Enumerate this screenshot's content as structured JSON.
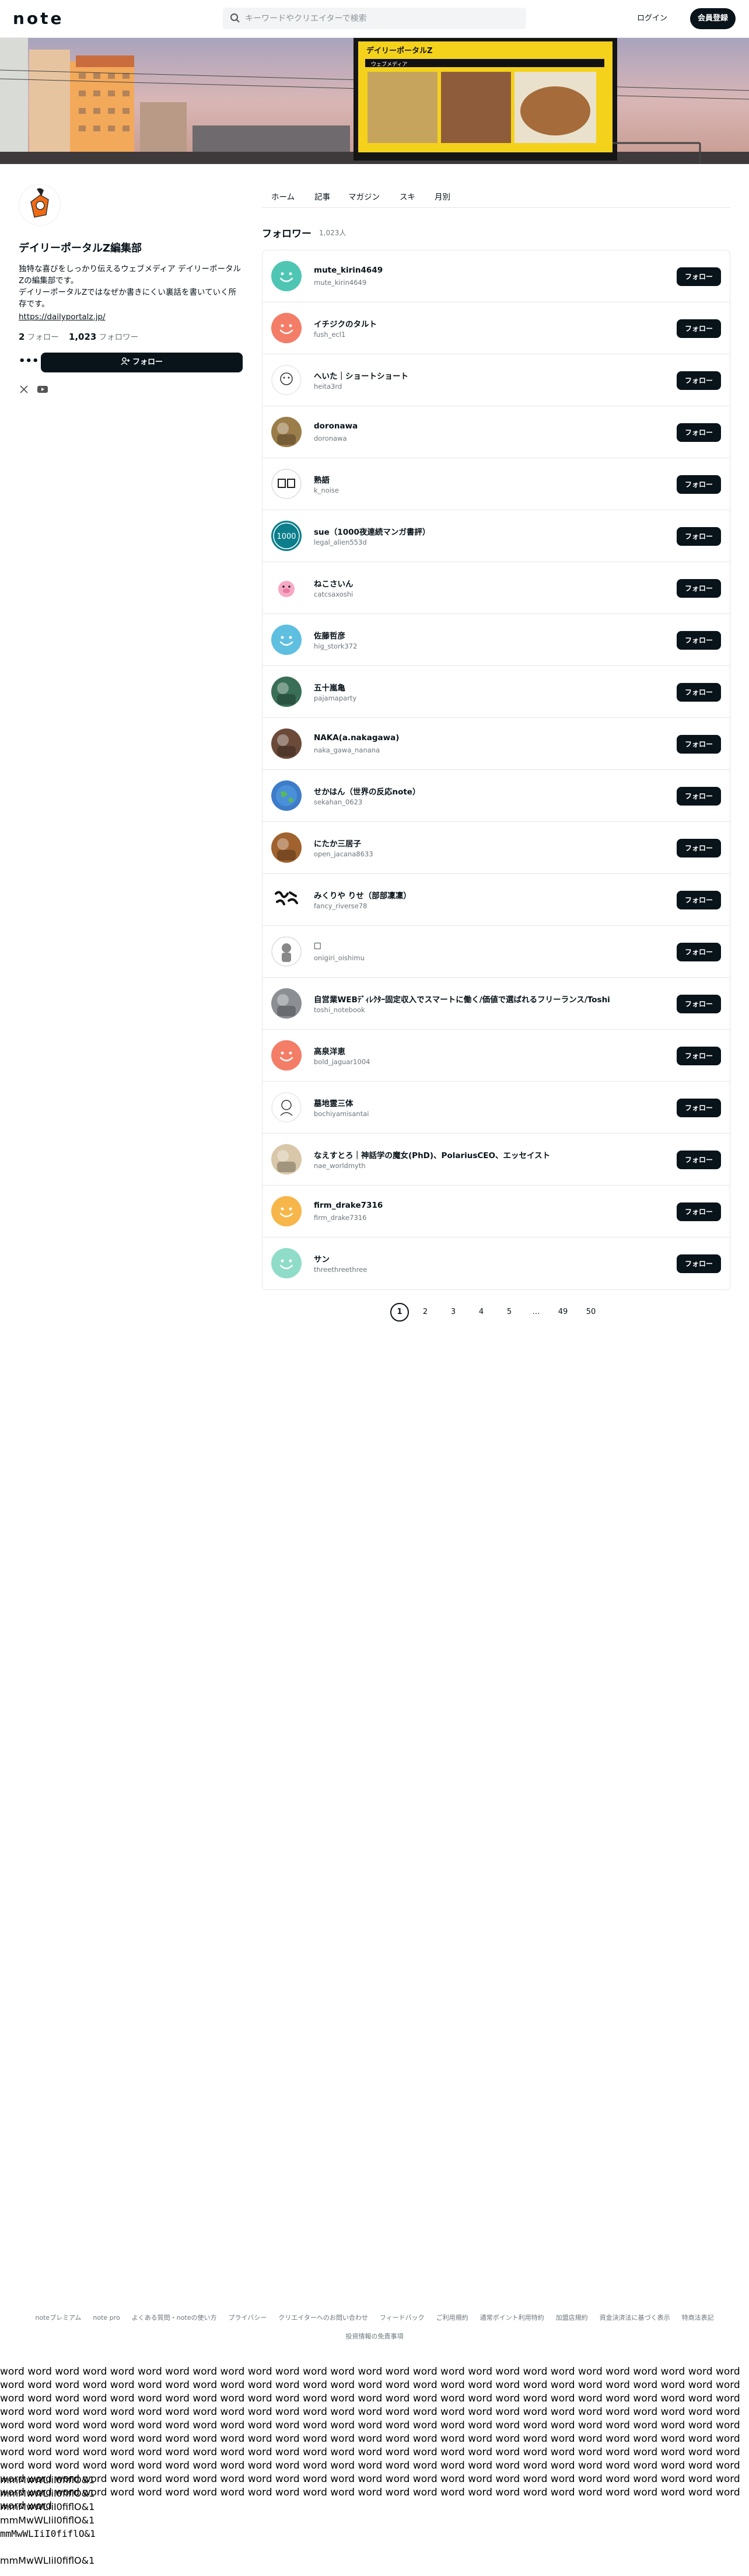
{
  "header": {
    "logo": "note",
    "search_placeholder": "キーワードやクリエイターで検索",
    "login": "ログイン",
    "signup": "会員登録"
  },
  "banner": {
    "sign_title": "デイリーポータルZ",
    "sign_sub": "ウェブメディア"
  },
  "profile": {
    "name": "デイリーポータルZ編集部",
    "bio": "独特な喜びをしっかり伝えるウェブメディア デイリーポータルZの編集部です。\nデイリーポータルZではなぜか書きにくい裏話を書いていく所存です。",
    "link": "https://dailyportalz.jp/",
    "following_count": "2",
    "following_label": "フォロー",
    "followers_count": "1,023",
    "followers_label": "フォロワー",
    "more": "•••",
    "follow_button": "フォロー"
  },
  "tabs": [
    "ホーム",
    "記事",
    "マガジン",
    "スキ",
    "月別"
  ],
  "section": {
    "title": "フォロワー",
    "count": "1,023人"
  },
  "followers": [
    {
      "name": "mute_kirin4649",
      "id": "mute_kirin4649",
      "avatar": "#4fc6b4",
      "avatar_kind": "smile",
      "button": "フォロー"
    },
    {
      "name": "イチジクのタルト",
      "id": "fush_ecl1",
      "avatar": "#f47d67",
      "avatar_kind": "smile",
      "button": "フォロー"
    },
    {
      "name": "へいた｜ショートショート",
      "id": "heita3rd",
      "avatar": "#ffffff",
      "avatar_kind": "illust",
      "button": "フォロー"
    },
    {
      "name": "doronawa",
      "id": "doronawa",
      "avatar": "#9b7d4a",
      "avatar_kind": "photo",
      "button": "フォロー"
    },
    {
      "name": "熟語",
      "id": "k_noise",
      "avatar": "#ffffff",
      "avatar_kind": "kanji",
      "button": "フォロー"
    },
    {
      "name": "sue（1000夜連続マンガ書評）",
      "id": "legal_alien553d",
      "avatar": "#0d7f8c",
      "avatar_kind": "text1000",
      "button": "フォロー"
    },
    {
      "name": "ねこさいん",
      "id": "catcsaxoshi",
      "avatar": "#ffffff",
      "avatar_kind": "pig",
      "button": "フォロー"
    },
    {
      "name": "佐藤哲彦",
      "id": "hig_stork372",
      "avatar": "#5fbfe0",
      "avatar_kind": "smile",
      "button": "フォロー"
    },
    {
      "name": "五十嵐亀",
      "id": "pajamaparty",
      "avatar": "#3a6f57",
      "avatar_kind": "photo",
      "button": "フォロー"
    },
    {
      "name": "NAKA(a.nakagawa)",
      "id": "naka_gawa_nanana",
      "avatar": "#6b4a3a",
      "avatar_kind": "photo",
      "button": "フォロー"
    },
    {
      "name": "せかはん（世界の反応note）",
      "id": "sekahan_0623",
      "avatar": "#3d7cc9",
      "avatar_kind": "globe",
      "button": "フォロー"
    },
    {
      "name": "にたか三居子",
      "id": "open_jacana8633",
      "avatar": "#a0622e",
      "avatar_kind": "photo",
      "button": "フォロー"
    },
    {
      "name": "みくりや りせ（部部凜凜）",
      "id": "fancy_riverse78",
      "avatar": "#ffffff",
      "avatar_kind": "brush",
      "button": "フォロー"
    },
    {
      "name": "□",
      "id": "onigiri_oishimu",
      "avatar": "#ffffff",
      "avatar_kind": "person",
      "button": "フォロー"
    },
    {
      "name": "自営業WEBﾃﾞｨﾚｸﾀｰ固定収入でスマートに働く/価値で選ばれるフリーランス/Toshi",
      "id": "toshi_notebook",
      "avatar": "#8b8f94",
      "avatar_kind": "photo",
      "button": "フォロー"
    },
    {
      "name": "高泉洋恵",
      "id": "bold_jaguar1004",
      "avatar": "#f47d67",
      "avatar_kind": "smile",
      "button": "フォロー"
    },
    {
      "name": "墓地霊三体",
      "id": "bochiyamisantai",
      "avatar": "#ffffff",
      "avatar_kind": "line",
      "button": "フォロー"
    },
    {
      "name": "なえすとろ｜神話学の魔女(PhD)、PolariusCEO、エッセイスト",
      "id": "nae_worldmyth",
      "avatar": "#d8c7a8",
      "avatar_kind": "photo",
      "button": "フォロー"
    },
    {
      "name": "firm_drake7316",
      "id": "firm_drake7316",
      "avatar": "#f7b64a",
      "avatar_kind": "smile",
      "button": "フォロー"
    },
    {
      "name": "サン",
      "id": "threethreethree",
      "avatar": "#8fdcc9",
      "avatar_kind": "smile",
      "button": "フォロー"
    }
  ],
  "pagination": {
    "pages": [
      "1",
      "2",
      "3",
      "4",
      "5",
      "…",
      "49",
      "50"
    ],
    "current": "1"
  },
  "footer": {
    "links": [
      "noteプレミアム",
      "note pro",
      "よくある質問・noteの使い方",
      "プライバシー",
      "クリエイターへのお問い合わせ",
      "フィードバック",
      "ご利用規約",
      "通常ポイント利用特約",
      "加盟店規約",
      "資金決済法に基づく表示",
      "特商法表記",
      "投資情報の免責事項"
    ]
  },
  "filler": {
    "text": "word word word word word word word word word word word word word word word word word word word word word word word word word word word word word word word word word word word word word word word word word word word word word word word word word word word word word word word word word word word word word word word word word word word word word word word word word word word word word word word word word word word word word word word word word word word word word word word word word word word word word word word word word word word word word word word word word word word word word word word word word word word word word word word word word word word word word word word word word word word word word word word word word word word word word word word word word word word word word word word word word word word word word word word word word word word word word word word word word word word word word word word word word word word word word word word word word word word word word word word word word word word word word word word word word word word word word word word word word word word word word word word word word word word word word word word word word word word word word word word word word word word word word word word word word word word word word word word word word word word word word word word word word word word word word word word word",
    "mono_lines": [
      "mmMwWLIiI0fiflO&1",
      "mmMwWLIiI0fiflO&1",
      "mmMwWLIiI0fiflO&1",
      "mmMwWLIiI0fiflO&1",
      "mmMwWLIiI0fiflO&1"
    ],
    "mono_last": "mmMwWLIiI0fiflO&1"
  }
}
